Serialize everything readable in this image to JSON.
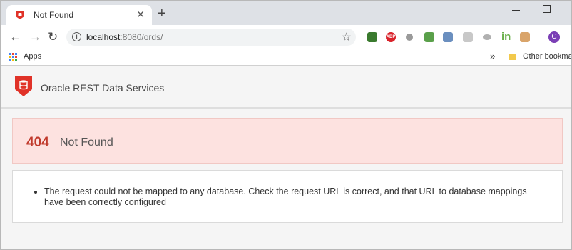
{
  "browser": {
    "tab_title": "Not Found",
    "tab_close": "✕",
    "new_tab": "+",
    "url_host": "localhost",
    "url_path": ":8080/ords/",
    "back_icon": "←",
    "forward_icon": "→",
    "reload_icon": "↻",
    "star_icon": "☆",
    "avatar_letter": "C",
    "abp_label": "ABP",
    "linkedin_label": "in"
  },
  "bookmarks": {
    "apps_label": "Apps",
    "more_icon": "»",
    "other_label": "Other bookma"
  },
  "page": {
    "service_title": "Oracle REST Data Services",
    "error_code": "404",
    "error_text": "Not Found",
    "message": "The request could not be mapped to any database. Check the request URL is correct, and that URL to database mappings have been correctly configured"
  },
  "colors": {
    "error_background": "#fde2e0",
    "error_code": "#c0392b",
    "brand_red": "#e03228"
  }
}
